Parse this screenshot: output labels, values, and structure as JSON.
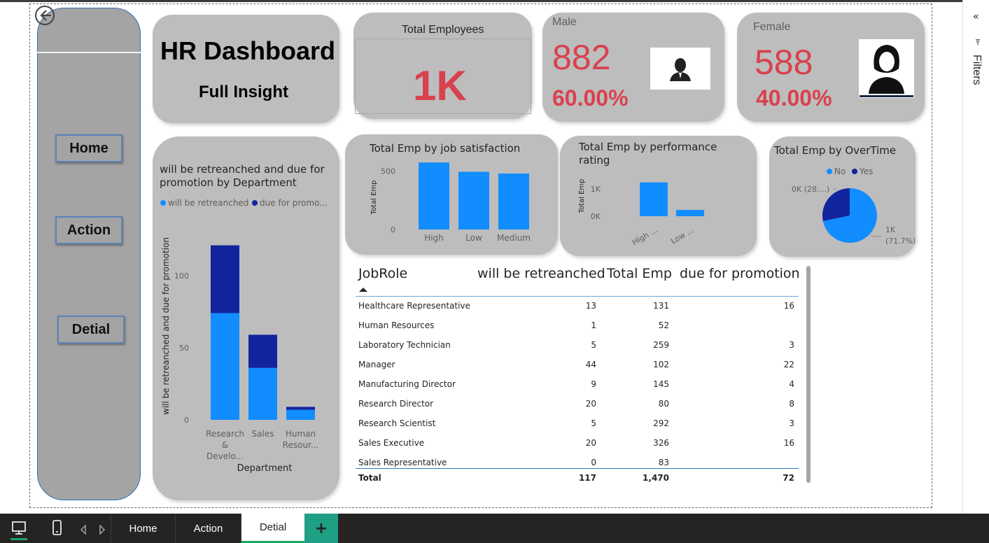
{
  "nav": {
    "buttons": [
      "Home",
      "Action",
      "Detial"
    ]
  },
  "title_card": {
    "title": "HR Dashboard",
    "subtitle": "Full Insight"
  },
  "kpi_total": {
    "label": "Total Employees",
    "value": "1K"
  },
  "kpi_male": {
    "label": "Male",
    "value": "882",
    "percent": "60.00%"
  },
  "kpi_female": {
    "label": "Female",
    "value": "588",
    "percent": "40.00%"
  },
  "colors": {
    "light_blue": "#118dff",
    "dark_blue": "#12239e",
    "kpi_red": "#d9414e",
    "card_gray": "#bdbdbd"
  },
  "chart_data": [
    {
      "type": "bar",
      "stacked": true,
      "title": "will be retreanched and due for promotion by Department",
      "xlabel": "Department",
      "ylabel": "will be retreanched and due for promotion",
      "legend": [
        "will be retreanched",
        "due for promo..."
      ],
      "legend_placement": "top-left",
      "categories": [
        "Research & Develo...",
        "Sales",
        "Human Resour..."
      ],
      "series": [
        {
          "name": "will be retreanched",
          "values": [
            74,
            36,
            7
          ]
        },
        {
          "name": "due for promotion",
          "values": [
            47,
            23,
            2
          ]
        }
      ],
      "yticks": [
        "0",
        "50",
        "100"
      ],
      "ylim": [
        0,
        130
      ]
    },
    {
      "type": "bar",
      "title": "Total Emp by job satisfaction",
      "ylabel": "Total Emp",
      "categories": [
        "High",
        "Low",
        "Medium"
      ],
      "values": [
        575,
        495,
        480
      ],
      "yticks": [
        "0",
        "500"
      ],
      "ylim": [
        0,
        600
      ]
    },
    {
      "type": "bar",
      "title": "Total Emp by performance rating",
      "ylabel": "Total Emp",
      "categories": [
        "High ...",
        "Low ..."
      ],
      "values": [
        1240,
        230
      ],
      "yticks": [
        "0K",
        "1K"
      ],
      "ylim": [
        0,
        1500
      ]
    },
    {
      "type": "pie",
      "title": "Total Emp by OverTime",
      "legend": [
        "No",
        "Yes"
      ],
      "legend_placement": "top",
      "slices": [
        {
          "name": "No",
          "value": 1054,
          "label": "1K",
          "pct_label": "(71.7%)"
        },
        {
          "name": "Yes",
          "value": 416,
          "label": "0K (28....)"
        }
      ]
    }
  ],
  "table": {
    "headers": [
      "JobRole",
      "will be retreanched",
      "Total Emp",
      "due for promotion"
    ],
    "rows": [
      [
        "Healthcare Representative",
        "13",
        "131",
        "16"
      ],
      [
        "Human Resources",
        "1",
        "52",
        ""
      ],
      [
        "Laboratory Technician",
        "5",
        "259",
        "3"
      ],
      [
        "Manager",
        "44",
        "102",
        "22"
      ],
      [
        "Manufacturing Director",
        "9",
        "145",
        "4"
      ],
      [
        "Research Director",
        "20",
        "80",
        "8"
      ],
      [
        "Research Scientist",
        "5",
        "292",
        "3"
      ],
      [
        "Sales Executive",
        "20",
        "326",
        "16"
      ],
      [
        "Sales Representative",
        "0",
        "83",
        ""
      ]
    ],
    "total": [
      "Total",
      "117",
      "1,470",
      "72"
    ]
  },
  "pane": {
    "filters_label": "Filters",
    "collapse_icon": "«"
  },
  "tabs": {
    "items": [
      "Home",
      "Action",
      "Detial"
    ],
    "close": "x",
    "add": "+"
  }
}
